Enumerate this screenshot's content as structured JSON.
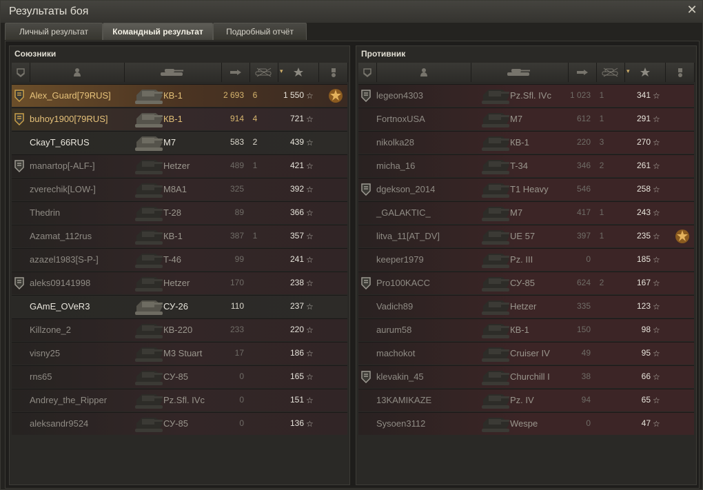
{
  "window": {
    "title": "Результаты боя"
  },
  "tabs": [
    {
      "label": "Личный результат"
    },
    {
      "label": "Командный результат"
    },
    {
      "label": "Подробный отчёт"
    }
  ],
  "allies": {
    "title": "Союзники",
    "rows": [
      {
        "name": "Alex_Guard[79RUS]",
        "tank": "КВ-1",
        "damage": "2 693",
        "kills": "6",
        "xp": "1 550",
        "badge": "1",
        "medal": "4",
        "style": "me"
      },
      {
        "name": "buhoy1900[79RUS]",
        "tank": "КВ-1",
        "damage": "914",
        "kills": "4",
        "xp": "721",
        "badge": "1",
        "medal": "",
        "style": "plat"
      },
      {
        "name": "CkayT_66RUS",
        "tank": "M7",
        "damage": "583",
        "kills": "2",
        "xp": "439",
        "badge": "",
        "medal": "",
        "style": "alive"
      },
      {
        "name": "manartop[-ALF-]",
        "tank": "Hetzer",
        "damage": "489",
        "kills": "1",
        "xp": "421",
        "badge": "2",
        "medal": "",
        "style": "ally"
      },
      {
        "name": "zverechik[LOW-]",
        "tank": "M8A1",
        "damage": "325",
        "kills": "",
        "xp": "392",
        "badge": "",
        "medal": "",
        "style": "ally"
      },
      {
        "name": "Thedrin",
        "tank": "T-28",
        "damage": "89",
        "kills": "",
        "xp": "366",
        "badge": "",
        "medal": "",
        "style": "ally"
      },
      {
        "name": "Azamat_112rus",
        "tank": "КВ-1",
        "damage": "387",
        "kills": "1",
        "xp": "357",
        "badge": "",
        "medal": "",
        "style": "ally"
      },
      {
        "name": "azazel1983[S-P-]",
        "tank": "T-46",
        "damage": "99",
        "kills": "",
        "xp": "241",
        "badge": "",
        "medal": "",
        "style": "ally"
      },
      {
        "name": "aleks09141998",
        "tank": "Hetzer",
        "damage": "170",
        "kills": "",
        "xp": "238",
        "badge": "2",
        "medal": "",
        "style": "ally"
      },
      {
        "name": "GAmE_OVeR3",
        "tank": "СУ-26",
        "damage": "110",
        "kills": "",
        "xp": "237",
        "badge": "",
        "medal": "",
        "style": "alive"
      },
      {
        "name": "Killzone_2",
        "tank": "КВ-220",
        "damage": "233",
        "kills": "",
        "xp": "220",
        "badge": "",
        "medal": "",
        "style": "ally"
      },
      {
        "name": "visny25",
        "tank": "M3 Stuart",
        "damage": "17",
        "kills": "",
        "xp": "186",
        "badge": "",
        "medal": "",
        "style": "ally"
      },
      {
        "name": "rns65",
        "tank": "СУ-85",
        "damage": "0",
        "kills": "",
        "xp": "165",
        "badge": "",
        "medal": "",
        "style": "ally"
      },
      {
        "name": "Andrey_the_Ripper",
        "tank": "Pz.Sfl. IVc",
        "damage": "0",
        "kills": "",
        "xp": "151",
        "badge": "",
        "medal": "",
        "style": "ally"
      },
      {
        "name": "aleksandr9524",
        "tank": "СУ-85",
        "damage": "0",
        "kills": "",
        "xp": "136",
        "badge": "",
        "medal": "",
        "style": "ally"
      }
    ]
  },
  "enemies": {
    "title": "Противник",
    "rows": [
      {
        "name": "legeon4303",
        "tank": "Pz.Sfl. IVc",
        "damage": "1 023",
        "kills": "1",
        "xp": "341",
        "badge": "2",
        "medal": "",
        "style": "enemy"
      },
      {
        "name": "FortnoxUSA",
        "tank": "M7",
        "damage": "612",
        "kills": "1",
        "xp": "291",
        "badge": "",
        "medal": "",
        "style": "enemy"
      },
      {
        "name": "nikolka28",
        "tank": "КВ-1",
        "damage": "220",
        "kills": "3",
        "xp": "270",
        "badge": "",
        "medal": "",
        "style": "enemy"
      },
      {
        "name": "micha_16",
        "tank": "T-34",
        "damage": "346",
        "kills": "2",
        "xp": "261",
        "badge": "",
        "medal": "",
        "style": "enemy"
      },
      {
        "name": "dgekson_2014",
        "tank": "T1 Heavy",
        "damage": "546",
        "kills": "",
        "xp": "258",
        "badge": "2",
        "medal": "",
        "style": "enemy"
      },
      {
        "name": "_GALAKTIC_",
        "tank": "M7",
        "damage": "417",
        "kills": "1",
        "xp": "243",
        "badge": "",
        "medal": "",
        "style": "enemy"
      },
      {
        "name": "litva_11[AT_DV]",
        "tank": "UE 57",
        "damage": "397",
        "kills": "1",
        "xp": "235",
        "badge": "",
        "medal": "1",
        "style": "enemy"
      },
      {
        "name": "keeper1979",
        "tank": "Pz. III",
        "damage": "0",
        "kills": "",
        "xp": "185",
        "badge": "",
        "medal": "",
        "style": "enemy"
      },
      {
        "name": "Pro100KACC",
        "tank": "СУ-85",
        "damage": "624",
        "kills": "2",
        "xp": "167",
        "badge": "2",
        "medal": "",
        "style": "enemy"
      },
      {
        "name": "Vadich89",
        "tank": "Hetzer",
        "damage": "335",
        "kills": "",
        "xp": "123",
        "badge": "",
        "medal": "",
        "style": "enemy"
      },
      {
        "name": "aurum58",
        "tank": "КВ-1",
        "damage": "150",
        "kills": "",
        "xp": "98",
        "badge": "",
        "medal": "",
        "style": "enemy"
      },
      {
        "name": "machokot",
        "tank": "Cruiser IV",
        "damage": "49",
        "kills": "",
        "xp": "95",
        "badge": "",
        "medal": "",
        "style": "enemy"
      },
      {
        "name": "klevakin_45",
        "tank": "Churchill I",
        "damage": "38",
        "kills": "",
        "xp": "66",
        "badge": "2",
        "medal": "",
        "style": "enemy"
      },
      {
        "name": "13KAMIKAZE",
        "tank": "Pz. IV",
        "damage": "94",
        "kills": "",
        "xp": "65",
        "badge": "",
        "medal": "",
        "style": "enemy"
      },
      {
        "name": "Sysoen3112",
        "tank": "Wespe",
        "damage": "0",
        "kills": "",
        "xp": "47",
        "badge": "",
        "medal": "",
        "style": "enemy"
      }
    ]
  },
  "icons": {
    "close": "close-icon",
    "squad": "squad-icon",
    "player": "player-icon",
    "tank": "tank-icon",
    "damage": "damage-icon",
    "kills": "kills-icon",
    "xp": "star-icon",
    "medal": "medal-icon"
  },
  "colors": {
    "accent": "#e6c27a",
    "enemy_row": "#3c2526",
    "ally_row": "#332627"
  }
}
